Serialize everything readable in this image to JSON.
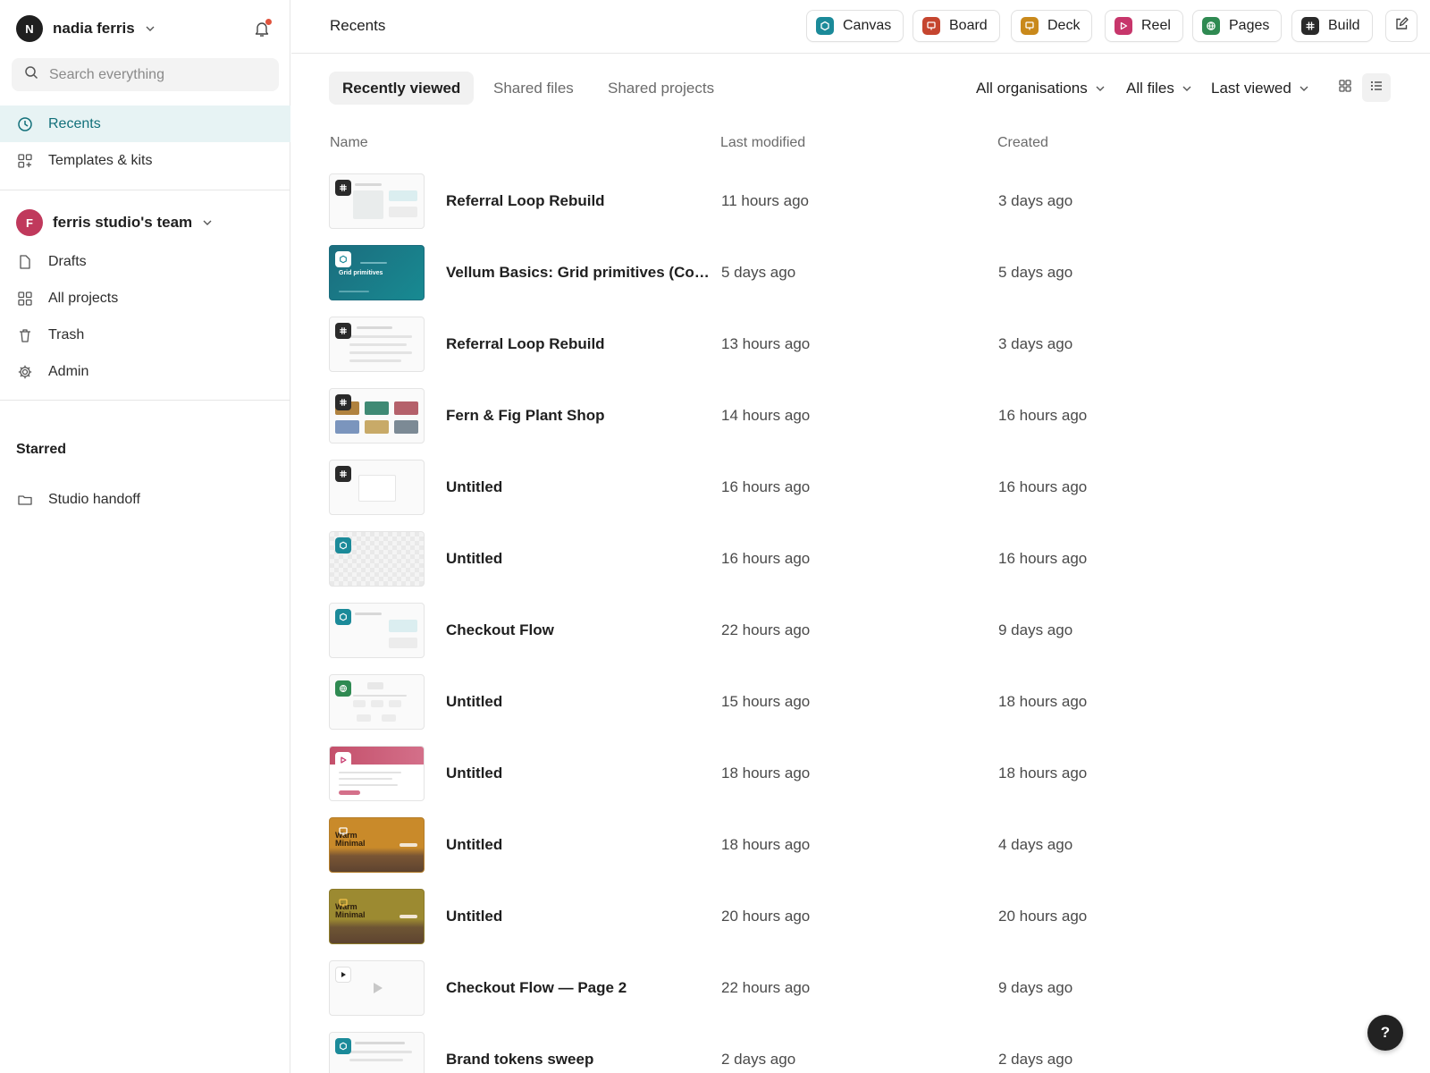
{
  "user": {
    "initial": "N",
    "name": "nadia ferris"
  },
  "search": {
    "placeholder": "Search everything"
  },
  "nav": {
    "recents": "Recents",
    "templates": "Templates & kits"
  },
  "team": {
    "initial": "F",
    "name": "ferris studio's team",
    "items": {
      "drafts": "Drafts",
      "projects": "All projects",
      "trash": "Trash",
      "admin": "Admin"
    }
  },
  "starred": {
    "title": "Starred",
    "items": [
      {
        "label": "Studio handoff"
      }
    ]
  },
  "header": {
    "title": "Recents",
    "create": [
      {
        "label": "Canvas",
        "icon": "canvas-icon",
        "color": "#1b8a99"
      },
      {
        "label": "Board",
        "icon": "board-icon",
        "color": "#c5452f"
      },
      {
        "label": "Deck",
        "icon": "deck-icon",
        "color": "#c9891b"
      },
      {
        "label": "Reel",
        "icon": "reel-icon",
        "color": "#c7366b"
      },
      {
        "label": "Pages",
        "icon": "pages-icon",
        "color": "#2f8a52"
      },
      {
        "label": "Build",
        "icon": "build-icon",
        "color": "#2a2a2a"
      }
    ]
  },
  "tabs": [
    "Recently viewed",
    "Shared files",
    "Shared projects"
  ],
  "filters": {
    "org": "All organisations",
    "files": "All files",
    "sort": "Last viewed"
  },
  "columns": {
    "name": "Name",
    "modified": "Last modified",
    "created": "Created"
  },
  "files": [
    {
      "name": "Referral Loop Rebuild",
      "modified": "11 hours ago",
      "created": "3 days ago",
      "type": "build"
    },
    {
      "name": "Vellum Basics: Grid primitives (Com...",
      "modified": "5 days ago",
      "created": "5 days ago",
      "type": "canvas",
      "thumb_title": "Grid primitives"
    },
    {
      "name": "Referral Loop Rebuild",
      "modified": "13 hours ago",
      "created": "3 days ago",
      "type": "build"
    },
    {
      "name": "Fern & Fig Plant Shop",
      "modified": "14 hours ago",
      "created": "16 hours ago",
      "type": "build"
    },
    {
      "name": "Untitled",
      "modified": "16 hours ago",
      "created": "16 hours ago",
      "type": "build"
    },
    {
      "name": "Untitled",
      "modified": "16 hours ago",
      "created": "16 hours ago",
      "type": "canvas"
    },
    {
      "name": "Checkout Flow",
      "modified": "22 hours ago",
      "created": "9 days ago",
      "type": "canvas"
    },
    {
      "name": "Untitled",
      "modified": "15 hours ago",
      "created": "18 hours ago",
      "type": "pages"
    },
    {
      "name": "Untitled",
      "modified": "18 hours ago",
      "created": "18 hours ago",
      "type": "reel"
    },
    {
      "name": "Untitled",
      "modified": "18 hours ago",
      "created": "4 days ago",
      "type": "deck",
      "thumb_title": "Warm Minimal"
    },
    {
      "name": "Untitled",
      "modified": "20 hours ago",
      "created": "20 hours ago",
      "type": "deck",
      "thumb_title": "Warm Minimal"
    },
    {
      "name": "Checkout Flow — Page 2",
      "modified": "22 hours ago",
      "created": "9 days ago",
      "type": "prototype"
    },
    {
      "name": "Brand tokens sweep",
      "modified": "2 days ago",
      "created": "2 days ago",
      "type": "canvas"
    }
  ],
  "help": {
    "label": "?"
  },
  "colors": {
    "accent": "#12707a",
    "active_bg": "#e7f3f4"
  }
}
